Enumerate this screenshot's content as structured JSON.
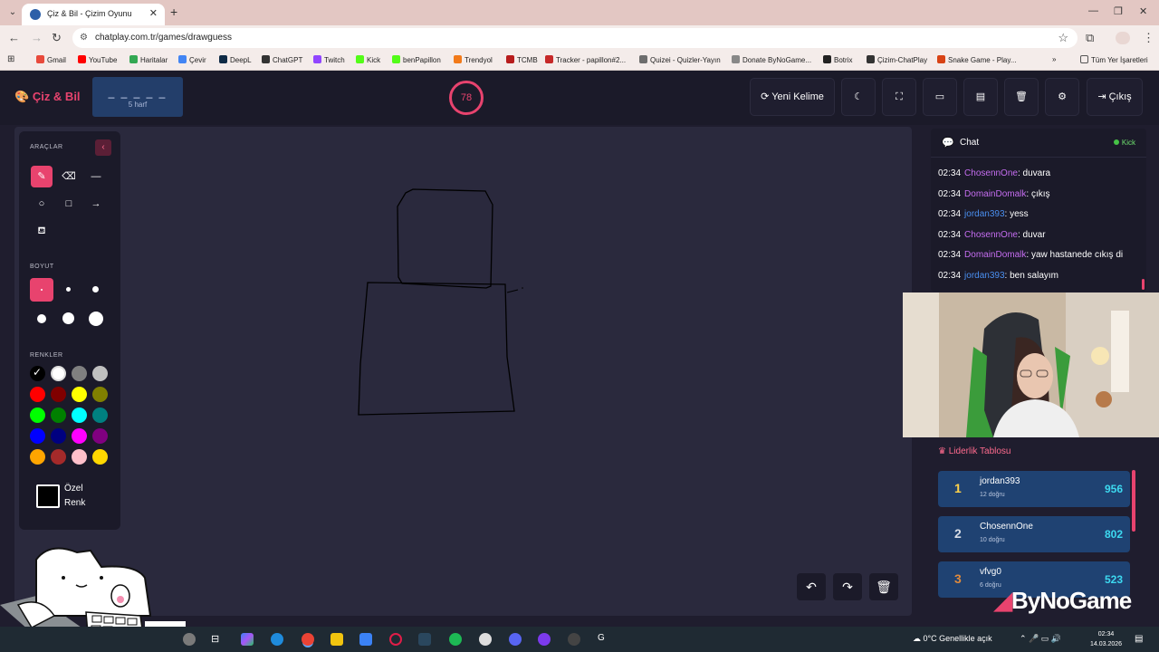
{
  "browser": {
    "tab_title": "Çiz & Bil - Çizim Oyunu",
    "url": "chatplay.com.tr/games/drawguess",
    "bookmarks": [
      "Gmail",
      "YouTube",
      "Haritalar",
      "Çevir",
      "DeepL",
      "ChatGPT",
      "Twitch",
      "Kick",
      "benPapillon",
      "Trendyol",
      "TCMB",
      "Tracker - papillon#2...",
      "Quizei - Quizler-Yayın",
      "Donate ByNoGame...",
      "Botrix",
      "Çizim-ChatPlay",
      "Snake Game - Play..."
    ],
    "all_bookmarks": "Tüm Yer İşaretleri"
  },
  "header": {
    "logo": "Çiz & Bil",
    "word_blanks": "_ _ _ _ _",
    "word_hint": "5 harf",
    "timer": "78",
    "new_word": "Yeni Kelime",
    "logout": "Çıkış"
  },
  "tools": {
    "tools_label": "ARAÇLAR",
    "size_label": "BOYUT",
    "colors_label": "RENKLER",
    "custom_color_line1": "Özel",
    "custom_color_line2": "Renk",
    "colors": [
      "#000000",
      "#ffffff",
      "#808080",
      "#c0c0c0",
      "#ff0000",
      "#800000",
      "#ffff00",
      "#808000",
      "#00ff00",
      "#008000",
      "#00ffff",
      "#008080",
      "#0000ff",
      "#000080",
      "#ff00ff",
      "#800080",
      "#ffa500",
      "#a52a2a",
      "#ffc0cb",
      "#ffd700"
    ]
  },
  "chat": {
    "title": "Chat",
    "platform": "Kick",
    "messages": [
      {
        "time": "02:34",
        "user": "ChosennOne",
        "text": ": duvara",
        "color": "#c56df0"
      },
      {
        "time": "02:34",
        "user": "DomainDomalk",
        "text": ": çıkış",
        "color": "#c56df0"
      },
      {
        "time": "02:34",
        "user": "jordan393",
        "text": ": yess",
        "color": "#4a8ff0"
      },
      {
        "time": "02:34",
        "user": "ChosennOne",
        "text": ": duvar",
        "color": "#c56df0"
      },
      {
        "time": "02:34",
        "user": "DomainDomalk",
        "text": ": yaw hastanede cıkış di",
        "color": "#c56df0"
      },
      {
        "time": "02:34",
        "user": "jordan393",
        "text": ": ben salayım",
        "color": "#4a8ff0"
      }
    ]
  },
  "leaderboard": {
    "title": "Liderlik Tablosu",
    "rows": [
      {
        "rank": "1",
        "name": "jordan393",
        "sub": "12 doğru",
        "score": "956",
        "rank_color": "#ffd24a"
      },
      {
        "rank": "2",
        "name": "ChosennOne",
        "sub": "10 doğru",
        "score": "802",
        "rank_color": "#d8dde6"
      },
      {
        "rank": "3",
        "name": "vfvg0",
        "sub": "6 doğru",
        "score": "523",
        "rank_color": "#e08a3c"
      }
    ]
  },
  "watermark": {
    "a": "By",
    "b": "NoGame"
  },
  "taskbar": {
    "weather": "0°C  Genellikle açık",
    "time": "02:34",
    "date": "14.03.2026"
  }
}
